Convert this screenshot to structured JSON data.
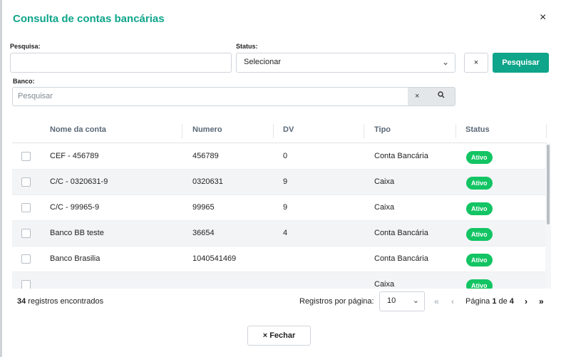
{
  "dialog": {
    "title": "Consulta de contas bancárias",
    "close_glyph": "×"
  },
  "filters": {
    "search_label": "Pesquisa:",
    "search_value": "",
    "status_label": "Status:",
    "status_selected": "Selecionar",
    "clear_glyph": "×",
    "search_button": "Pesquisar",
    "bank_label": "Banco:",
    "bank_placeholder": "Pesquisar",
    "bank_clear_glyph": "×",
    "bank_search_glyph": "🔍"
  },
  "table": {
    "headers": [
      "Nome da conta",
      "Numero",
      "DV",
      "Tipo",
      "Status"
    ],
    "rows": [
      {
        "name": "CEF - 456789",
        "number": "456789",
        "dv": "0",
        "type": "Conta Bancária",
        "status": "Ativo"
      },
      {
        "name": "C/C - 0320631-9",
        "number": "0320631",
        "dv": "9",
        "type": "Caixa",
        "status": "Ativo"
      },
      {
        "name": "C/C - 99965-9",
        "number": "99965",
        "dv": "9",
        "type": "Caixa",
        "status": "Ativo"
      },
      {
        "name": "Banco BB teste",
        "number": "36654",
        "dv": "4",
        "type": "Conta Bancária",
        "status": "Ativo"
      },
      {
        "name": "Banco Brasilia",
        "number": "1040541469",
        "dv": "",
        "type": "Conta Bancária",
        "status": "Ativo"
      },
      {
        "name": "",
        "number": "",
        "dv": "",
        "type": "Caixa",
        "status": "Ativo"
      }
    ]
  },
  "footer": {
    "count": "34",
    "count_suffix": " registros encontrados",
    "per_page_label": "Registros por página:",
    "per_page_value": "10",
    "first_glyph": "«",
    "prev_glyph": "‹",
    "page_prefix": "Página ",
    "page_current": "1",
    "page_of": " de ",
    "page_total": "4",
    "next_glyph": "›",
    "last_glyph": "»"
  },
  "close_button": "× Fechar",
  "colors": {
    "accent": "#0ea58a",
    "active_badge": "#12c463"
  }
}
